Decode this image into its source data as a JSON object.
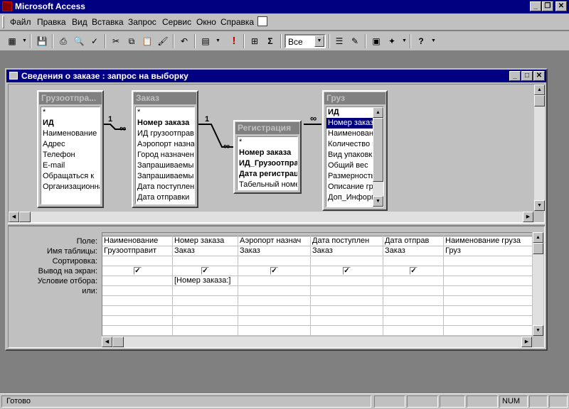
{
  "app": {
    "title": "Microsoft Access"
  },
  "menu": [
    {
      "label": "Файл",
      "name": "menu-file"
    },
    {
      "label": "Правка",
      "name": "menu-edit"
    },
    {
      "label": "Вид",
      "name": "menu-view"
    },
    {
      "label": "Вставка",
      "name": "menu-insert"
    },
    {
      "label": "Запрос",
      "name": "menu-query"
    },
    {
      "label": "Сервис",
      "name": "menu-tools"
    },
    {
      "label": "Окно",
      "name": "menu-window"
    },
    {
      "label": "Справка",
      "name": "menu-help"
    }
  ],
  "toolbar": {
    "top_values": "Все",
    "sigma": "Σ",
    "run": "!"
  },
  "query_window": {
    "title": "Сведения о заказе : запрос на выборку",
    "relations": {
      "one": "1",
      "many": "∞"
    },
    "tables": [
      {
        "title": "Грузоотпра...",
        "fields": [
          "*",
          "ИД",
          "Наименование",
          "Адрес",
          "Телефон",
          "E-mail",
          "Обращаться к",
          "Организационна"
        ],
        "keys": [
          1
        ]
      },
      {
        "title": "Заказ",
        "fields": [
          "*",
          "Номер заказа",
          "ИД грузоотправ",
          "Аэропорт назнач",
          "Город назначени",
          "Запрашиваемый",
          "Запрашиваемый",
          "Дата поступлен",
          "Дата отправки"
        ],
        "keys": [
          1
        ]
      },
      {
        "title": "Регистрация",
        "fields": [
          "*",
          "Номер заказа",
          "ИД_Грузоотправ",
          "Дата регистрац",
          "Табельный номе"
        ],
        "keys": [
          1,
          2,
          3
        ]
      },
      {
        "title": "Груз",
        "fields": [
          "ИД",
          "Номер заказа",
          "Наименовани",
          "Количество м",
          "Вид упаковки",
          "Общий вес",
          "Размерность",
          "Описание гру",
          "Доп_Информа"
        ],
        "keys": [
          0
        ],
        "selected": 1
      }
    ],
    "grid": {
      "row_labels": [
        "Поле:",
        "Имя таблицы:",
        "Сортировка:",
        "Вывод на экран:",
        "Условие отбора:",
        "или:"
      ],
      "columns": [
        {
          "field": "Наименование",
          "table": "Грузоотправит",
          "show": true,
          "criteria": ""
        },
        {
          "field": "Номер заказа",
          "table": "Заказ",
          "show": true,
          "criteria": "[Номер заказа:]"
        },
        {
          "field": "Аэропорт назнач",
          "table": "Заказ",
          "show": true,
          "criteria": ""
        },
        {
          "field": "Дата поступлен",
          "table": "Заказ",
          "show": true,
          "criteria": ""
        },
        {
          "field": "Дата отправ",
          "table": "Заказ",
          "show": true,
          "criteria": ""
        },
        {
          "field": "Наименование груза",
          "table": "Груз",
          "show": false,
          "criteria": ""
        }
      ]
    }
  },
  "status": {
    "text": "Готово",
    "num": "NUM"
  }
}
